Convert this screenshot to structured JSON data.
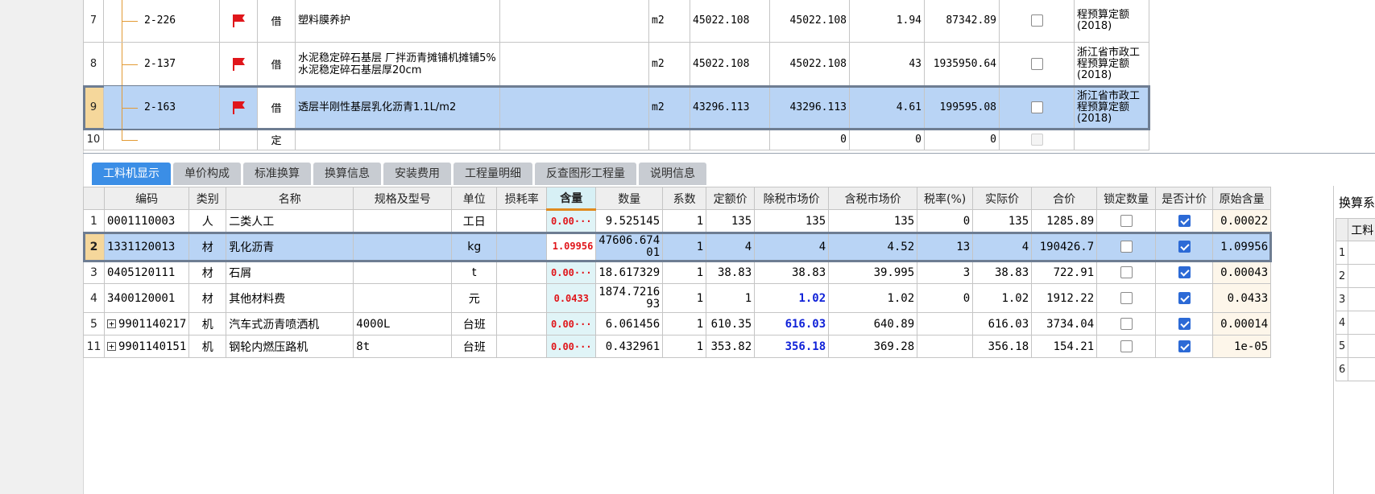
{
  "quota_rows": [
    {
      "row": "7",
      "code": "2-226",
      "type": "借",
      "name": "塑料膜养护",
      "spec": "",
      "unit": "m2",
      "qty_expr": "45022.108",
      "qty": "45022.108",
      "price": "1.94",
      "total": "87342.89",
      "lib": "程预算定额 (2018)",
      "flag": true,
      "checkbox": "off",
      "tree": "mid"
    },
    {
      "row": "8",
      "code": "2-137",
      "type": "借",
      "name": "水泥稳定碎石基层 厂拌沥青摊铺机摊铺5%水泥稳定碎石基层厚20cm",
      "spec": "",
      "unit": "m2",
      "qty_expr": "45022.108",
      "qty": "45022.108",
      "price": "43",
      "total": "1935950.64",
      "lib": "浙江省市政工程预算定额 (2018)",
      "flag": true,
      "checkbox": "off",
      "tree": "mid"
    },
    {
      "row": "9",
      "code": "2-163",
      "type": "借",
      "name": "透层半刚性基层乳化沥青1.1L/m2",
      "spec": "",
      "unit": "m2",
      "qty_expr": "43296.113",
      "qty": "43296.113",
      "price": "4.61",
      "total": "199595.08",
      "lib": "浙江省市政工程预算定额 (2018)",
      "flag": true,
      "checkbox": "off",
      "tree": "mid",
      "selected": true
    },
    {
      "row": "10",
      "code": "",
      "type": "定",
      "name": "",
      "spec": "",
      "unit": "",
      "qty_expr": "",
      "qty": "0",
      "price": "0",
      "total": "0",
      "lib": "",
      "flag": false,
      "checkbox": "disabled",
      "tree": "end"
    }
  ],
  "tabs": [
    {
      "label": "工料机显示",
      "active": true
    },
    {
      "label": "单价构成"
    },
    {
      "label": "标准换算"
    },
    {
      "label": "换算信息"
    },
    {
      "label": "安装费用"
    },
    {
      "label": "工程量明细"
    },
    {
      "label": "反查图形工程量"
    },
    {
      "label": "说明信息"
    }
  ],
  "material_headers": [
    "",
    "编码",
    "类别",
    "名称",
    "规格及型号",
    "单位",
    "损耗率",
    "含量",
    "数量",
    "系数",
    "定额价",
    "除税市场价",
    "含税市场价",
    "税率(%)",
    "实际价",
    "合价",
    "锁定数量",
    "是否计价",
    "原始含量"
  ],
  "material_rows": [
    {
      "row": "1",
      "code": "0001110003",
      "cat": "人",
      "name": "二类人工",
      "spec": "",
      "unit": "工日",
      "loss": "",
      "content": "0.00···",
      "qty": "9.525145",
      "coef": "1",
      "quota_price": "135",
      "market_ex": "135",
      "market_in": "135",
      "tax": "0",
      "actual": "135",
      "total": "1285.89",
      "locked": false,
      "priced": true,
      "orig": "0.00022"
    },
    {
      "row": "2",
      "code": "1331120013",
      "cat": "材",
      "name": "乳化沥青",
      "spec": "",
      "unit": "kg",
      "loss": "",
      "content": "1.09956",
      "qty": "47606.67401",
      "coef": "1",
      "quota_price": "4",
      "market_ex": "4",
      "market_in": "4.52",
      "tax": "13",
      "actual": "4",
      "total": "190426.7",
      "locked": false,
      "priced": true,
      "orig": "1.09956",
      "selected": true
    },
    {
      "row": "3",
      "code": "0405120111",
      "cat": "材",
      "name": "石屑",
      "spec": "",
      "unit": "t",
      "loss": "",
      "content": "0.00···",
      "qty": "18.617329",
      "coef": "1",
      "quota_price": "38.83",
      "market_ex": "38.83",
      "market_in": "39.995",
      "tax": "3",
      "actual": "38.83",
      "total": "722.91",
      "locked": false,
      "priced": true,
      "orig": "0.00043"
    },
    {
      "row": "4",
      "code": "3400120001",
      "cat": "材",
      "name": "其他材料费",
      "spec": "",
      "unit": "元",
      "loss": "",
      "content": "0.0433",
      "qty": "1874.721693",
      "coef": "1",
      "quota_price": "1",
      "market_ex": "1.02",
      "market_in": "1.02",
      "tax": "0",
      "actual": "1.02",
      "total": "1912.22",
      "locked": false,
      "priced": true,
      "orig": "0.0433",
      "ex_blue": true
    },
    {
      "row": "5",
      "code": "9901140217",
      "cat": "机",
      "name": "汽车式沥青喷洒机",
      "spec": "4000L",
      "unit": "台班",
      "loss": "",
      "content": "0.00···",
      "qty": "6.061456",
      "coef": "1",
      "quota_price": "610.35",
      "market_ex": "616.03",
      "market_in": "640.89",
      "tax": "",
      "actual": "616.03",
      "total": "3734.04",
      "locked": false,
      "priced": true,
      "orig": "0.00014",
      "ex_blue": true,
      "expand": true
    },
    {
      "row": "11",
      "code": "9901140151",
      "cat": "机",
      "name": "钢轮内燃压路机",
      "spec": "8t",
      "unit": "台班",
      "loss": "",
      "content": "0.00···",
      "qty": "0.432961",
      "coef": "1",
      "quota_price": "353.82",
      "market_ex": "356.18",
      "market_in": "369.28",
      "tax": "",
      "actual": "356.18",
      "total": "154.21",
      "locked": false,
      "priced": true,
      "orig": "1e-05",
      "ex_blue": true,
      "expand": true
    }
  ],
  "side_panel": {
    "title": "换算系",
    "header": "工料",
    "rows": [
      "1",
      "2",
      "3",
      "4",
      "5",
      "6"
    ]
  },
  "colors": {
    "accent": "#3b8ee6",
    "selected_row": "#b9d4f5",
    "red_value": "#e0161b",
    "blue_value": "#1022d8",
    "flag": "#e0161b"
  }
}
